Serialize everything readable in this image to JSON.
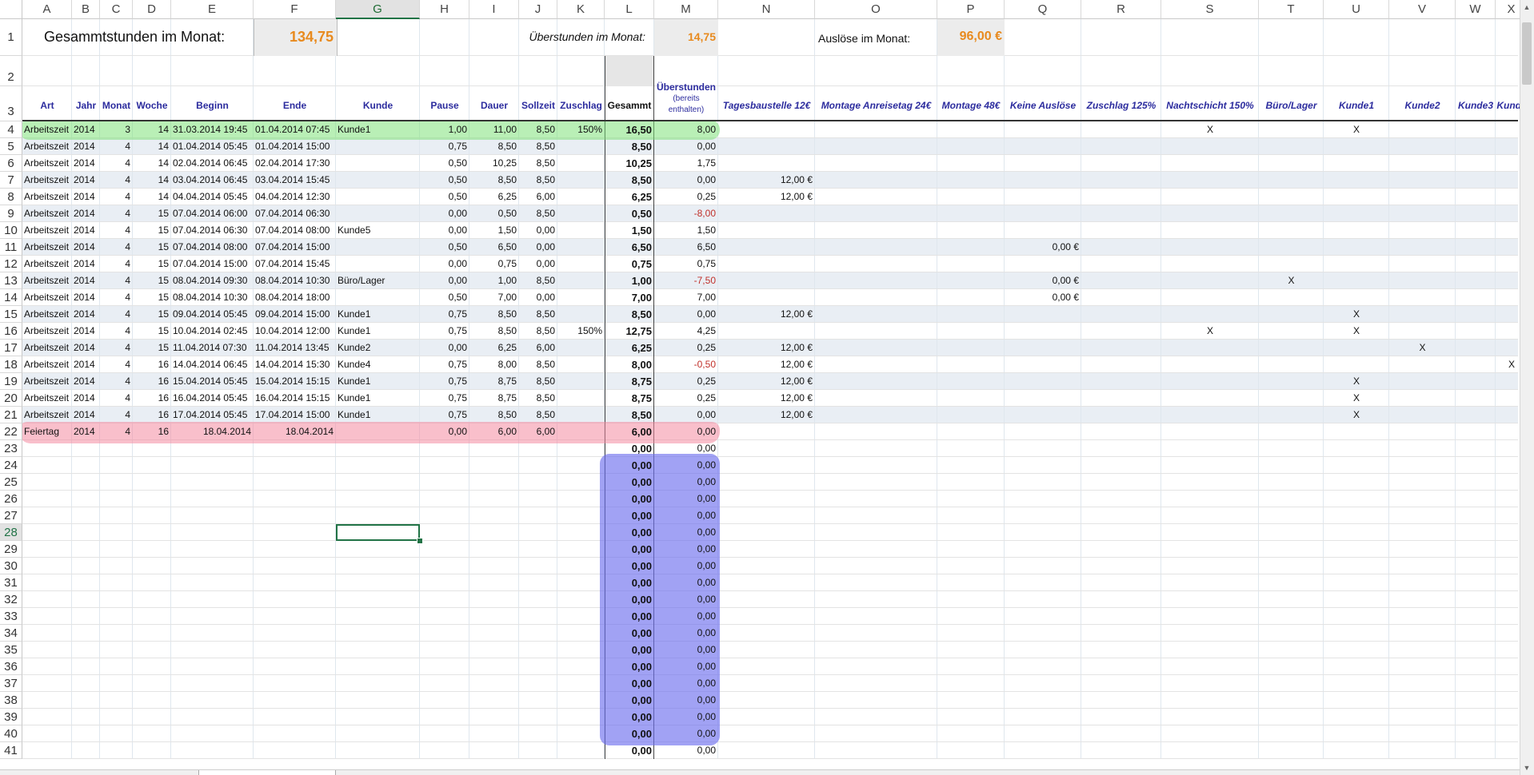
{
  "columns": [
    "A",
    "B",
    "C",
    "D",
    "E",
    "F",
    "G",
    "H",
    "I",
    "J",
    "K",
    "L",
    "M",
    "N",
    "O",
    "P",
    "Q",
    "R",
    "S",
    "T",
    "U",
    "V",
    "W",
    "X"
  ],
  "selected_column": "G",
  "selected_row": 28,
  "row_numbers": [
    1,
    2,
    3,
    4,
    5,
    6,
    7,
    8,
    9,
    10,
    11,
    12,
    13,
    14,
    15,
    16,
    17,
    18,
    19,
    20,
    21,
    22,
    23,
    24,
    25,
    26,
    27,
    28,
    29,
    30,
    31,
    32,
    33,
    34,
    35,
    36,
    37,
    38,
    39,
    40,
    41
  ],
  "summary": {
    "hours_label": "Gesammtstunden im Monat:",
    "hours_value": "134,75",
    "overtime_label": "Überstunden im Monat:",
    "overtime_value": "14,75",
    "allowance_label": "Auslöse im Monat:",
    "allowance_value": "96,00 €"
  },
  "headers": {
    "art": "Art",
    "jahr": "Jahr",
    "monat": "Monat",
    "woche": "Woche",
    "beginn": "Beginn",
    "ende": "Ende",
    "kunde": "Kunde",
    "pause": "Pause",
    "dauer": "Dauer",
    "sollzeit": "Sollzeit",
    "zuschlag": "Zuschlag",
    "gesammt": "Gesammt",
    "ueberstunden": "Überstunden",
    "ueberstunden_sub1": "(bereits",
    "ueberstunden_sub2": "enthalten)",
    "tagesbaustelle": "Tagesbaustelle 12€",
    "montage_anreise": "Montage Anreisetag 24€",
    "montage48": "Montage 48€",
    "keine_ausloese": "Keine Auslöse",
    "zuschlag125": "Zuschlag 125%",
    "nachtschicht": "Nachtschicht 150%",
    "buero": "Büro/Lager",
    "kunde1": "Kunde1",
    "kunde2": "Kunde2",
    "kunde3": "Kunde3",
    "kunde_x": "Kunde"
  },
  "rows": [
    {
      "row": 4,
      "art": "Arbeitszeit",
      "jahr": "2014",
      "monat": "3",
      "woche": "14",
      "beginn": "31.03.2014 19:45",
      "ende": "01.04.2014 07:45",
      "kunde": "Kunde1",
      "pause": "1,00",
      "dauer": "11,00",
      "soll": "8,50",
      "zuschlag": "150%",
      "gesammt": "16,50",
      "ueber": "8,00",
      "tages": "",
      "keine": "",
      "nacht": "X",
      "buero": "",
      "k1": "X",
      "k2": "",
      "kx": ""
    },
    {
      "row": 5,
      "art": "Arbeitszeit",
      "jahr": "2014",
      "monat": "4",
      "woche": "14",
      "beginn": "01.04.2014 05:45",
      "ende": "01.04.2014 15:00",
      "kunde": "",
      "pause": "0,75",
      "dauer": "8,50",
      "soll": "8,50",
      "zuschlag": "",
      "gesammt": "8,50",
      "ueber": "0,00",
      "tages": "",
      "keine": "",
      "nacht": "",
      "buero": "",
      "k1": "",
      "k2": "",
      "kx": ""
    },
    {
      "row": 6,
      "art": "Arbeitszeit",
      "jahr": "2014",
      "monat": "4",
      "woche": "14",
      "beginn": "02.04.2014 06:45",
      "ende": "02.04.2014 17:30",
      "kunde": "",
      "pause": "0,50",
      "dauer": "10,25",
      "soll": "8,50",
      "zuschlag": "",
      "gesammt": "10,25",
      "ueber": "1,75",
      "tages": "",
      "keine": "",
      "nacht": "",
      "buero": "",
      "k1": "",
      "k2": "",
      "kx": ""
    },
    {
      "row": 7,
      "art": "Arbeitszeit",
      "jahr": "2014",
      "monat": "4",
      "woche": "14",
      "beginn": "03.04.2014 06:45",
      "ende": "03.04.2014 15:45",
      "kunde": "",
      "pause": "0,50",
      "dauer": "8,50",
      "soll": "8,50",
      "zuschlag": "",
      "gesammt": "8,50",
      "ueber": "0,00",
      "tages": "12,00 €",
      "keine": "",
      "nacht": "",
      "buero": "",
      "k1": "",
      "k2": "",
      "kx": ""
    },
    {
      "row": 8,
      "art": "Arbeitszeit",
      "jahr": "2014",
      "monat": "4",
      "woche": "14",
      "beginn": "04.04.2014 05:45",
      "ende": "04.04.2014 12:30",
      "kunde": "",
      "pause": "0,50",
      "dauer": "6,25",
      "soll": "6,00",
      "zuschlag": "",
      "gesammt": "6,25",
      "ueber": "0,25",
      "tages": "12,00 €",
      "keine": "",
      "nacht": "",
      "buero": "",
      "k1": "",
      "k2": "",
      "kx": ""
    },
    {
      "row": 9,
      "art": "Arbeitszeit",
      "jahr": "2014",
      "monat": "4",
      "woche": "15",
      "beginn": "07.04.2014 06:00",
      "ende": "07.04.2014 06:30",
      "kunde": "",
      "pause": "0,00",
      "dauer": "0,50",
      "soll": "8,50",
      "zuschlag": "",
      "gesammt": "0,50",
      "ueber": "-8,00",
      "tages": "",
      "keine": "",
      "nacht": "",
      "buero": "",
      "k1": "",
      "k2": "",
      "kx": ""
    },
    {
      "row": 10,
      "art": "Arbeitszeit",
      "jahr": "2014",
      "monat": "4",
      "woche": "15",
      "beginn": "07.04.2014 06:30",
      "ende": "07.04.2014 08:00",
      "kunde": "Kunde5",
      "pause": "0,00",
      "dauer": "1,50",
      "soll": "0,00",
      "zuschlag": "",
      "gesammt": "1,50",
      "ueber": "1,50",
      "tages": "",
      "keine": "",
      "nacht": "",
      "buero": "",
      "k1": "",
      "k2": "",
      "kx": ""
    },
    {
      "row": 11,
      "art": "Arbeitszeit",
      "jahr": "2014",
      "monat": "4",
      "woche": "15",
      "beginn": "07.04.2014 08:00",
      "ende": "07.04.2014 15:00",
      "kunde": "",
      "pause": "0,50",
      "dauer": "6,50",
      "soll": "0,00",
      "zuschlag": "",
      "gesammt": "6,50",
      "ueber": "6,50",
      "tages": "",
      "keine": "0,00 €",
      "nacht": "",
      "buero": "",
      "k1": "",
      "k2": "",
      "kx": ""
    },
    {
      "row": 12,
      "art": "Arbeitszeit",
      "jahr": "2014",
      "monat": "4",
      "woche": "15",
      "beginn": "07.04.2014 15:00",
      "ende": "07.04.2014 15:45",
      "kunde": "",
      "pause": "0,00",
      "dauer": "0,75",
      "soll": "0,00",
      "zuschlag": "",
      "gesammt": "0,75",
      "ueber": "0,75",
      "tages": "",
      "keine": "",
      "nacht": "",
      "buero": "",
      "k1": "",
      "k2": "",
      "kx": ""
    },
    {
      "row": 13,
      "art": "Arbeitszeit",
      "jahr": "2014",
      "monat": "4",
      "woche": "15",
      "beginn": "08.04.2014 09:30",
      "ende": "08.04.2014 10:30",
      "kunde": "Büro/Lager",
      "pause": "0,00",
      "dauer": "1,00",
      "soll": "8,50",
      "zuschlag": "",
      "gesammt": "1,00",
      "ueber": "-7,50",
      "tages": "",
      "keine": "0,00 €",
      "nacht": "",
      "buero": "X",
      "k1": "",
      "k2": "",
      "kx": ""
    },
    {
      "row": 14,
      "art": "Arbeitszeit",
      "jahr": "2014",
      "monat": "4",
      "woche": "15",
      "beginn": "08.04.2014 10:30",
      "ende": "08.04.2014 18:00",
      "kunde": "",
      "pause": "0,50",
      "dauer": "7,00",
      "soll": "0,00",
      "zuschlag": "",
      "gesammt": "7,00",
      "ueber": "7,00",
      "tages": "",
      "keine": "0,00 €",
      "nacht": "",
      "buero": "",
      "k1": "",
      "k2": "",
      "kx": ""
    },
    {
      "row": 15,
      "art": "Arbeitszeit",
      "jahr": "2014",
      "monat": "4",
      "woche": "15",
      "beginn": "09.04.2014 05:45",
      "ende": "09.04.2014 15:00",
      "kunde": "Kunde1",
      "pause": "0,75",
      "dauer": "8,50",
      "soll": "8,50",
      "zuschlag": "",
      "gesammt": "8,50",
      "ueber": "0,00",
      "tages": "12,00 €",
      "keine": "",
      "nacht": "",
      "buero": "",
      "k1": "X",
      "k2": "",
      "kx": ""
    },
    {
      "row": 16,
      "art": "Arbeitszeit",
      "jahr": "2014",
      "monat": "4",
      "woche": "15",
      "beginn": "10.04.2014 02:45",
      "ende": "10.04.2014 12:00",
      "kunde": "Kunde1",
      "pause": "0,75",
      "dauer": "8,50",
      "soll": "8,50",
      "zuschlag": "150%",
      "gesammt": "12,75",
      "ueber": "4,25",
      "tages": "",
      "keine": "",
      "nacht": "X",
      "buero": "",
      "k1": "X",
      "k2": "",
      "kx": ""
    },
    {
      "row": 17,
      "art": "Arbeitszeit",
      "jahr": "2014",
      "monat": "4",
      "woche": "15",
      "beginn": "11.04.2014 07:30",
      "ende": "11.04.2014 13:45",
      "kunde": "Kunde2",
      "pause": "0,00",
      "dauer": "6,25",
      "soll": "6,00",
      "zuschlag": "",
      "gesammt": "6,25",
      "ueber": "0,25",
      "tages": "12,00 €",
      "keine": "",
      "nacht": "",
      "buero": "",
      "k1": "",
      "k2": "X",
      "kx": ""
    },
    {
      "row": 18,
      "art": "Arbeitszeit",
      "jahr": "2014",
      "monat": "4",
      "woche": "16",
      "beginn": "14.04.2014 06:45",
      "ende": "14.04.2014 15:30",
      "kunde": "Kunde4",
      "pause": "0,75",
      "dauer": "8,00",
      "soll": "8,50",
      "zuschlag": "",
      "gesammt": "8,00",
      "ueber": "-0,50",
      "tages": "12,00 €",
      "keine": "",
      "nacht": "",
      "buero": "",
      "k1": "",
      "k2": "",
      "kx": "X"
    },
    {
      "row": 19,
      "art": "Arbeitszeit",
      "jahr": "2014",
      "monat": "4",
      "woche": "16",
      "beginn": "15.04.2014 05:45",
      "ende": "15.04.2014 15:15",
      "kunde": "Kunde1",
      "pause": "0,75",
      "dauer": "8,75",
      "soll": "8,50",
      "zuschlag": "",
      "gesammt": "8,75",
      "ueber": "0,25",
      "tages": "12,00 €",
      "keine": "",
      "nacht": "",
      "buero": "",
      "k1": "X",
      "k2": "",
      "kx": ""
    },
    {
      "row": 20,
      "art": "Arbeitszeit",
      "jahr": "2014",
      "monat": "4",
      "woche": "16",
      "beginn": "16.04.2014 05:45",
      "ende": "16.04.2014 15:15",
      "kunde": "Kunde1",
      "pause": "0,75",
      "dauer": "8,75",
      "soll": "8,50",
      "zuschlag": "",
      "gesammt": "8,75",
      "ueber": "0,25",
      "tages": "12,00 €",
      "keine": "",
      "nacht": "",
      "buero": "",
      "k1": "X",
      "k2": "",
      "kx": ""
    },
    {
      "row": 21,
      "art": "Arbeitszeit",
      "jahr": "2014",
      "monat": "4",
      "woche": "16",
      "beginn": "17.04.2014 05:45",
      "ende": "17.04.2014 15:00",
      "kunde": "Kunde1",
      "pause": "0,75",
      "dauer": "8,50",
      "soll": "8,50",
      "zuschlag": "",
      "gesammt": "8,50",
      "ueber": "0,00",
      "tages": "12,00 €",
      "keine": "",
      "nacht": "",
      "buero": "",
      "k1": "X",
      "k2": "",
      "kx": ""
    },
    {
      "row": 22,
      "art": "Feiertag",
      "jahr": "2014",
      "monat": "4",
      "woche": "16",
      "beginn": "18.04.2014",
      "ende": "18.04.2014",
      "kunde": "",
      "pause": "0,00",
      "dauer": "6,00",
      "soll": "6,00",
      "zuschlag": "",
      "gesammt": "6,00",
      "ueber": "0,00",
      "tages": "",
      "keine": "",
      "nacht": "",
      "buero": "",
      "k1": "",
      "k2": "",
      "kx": ""
    }
  ],
  "empty_rows": {
    "from": 23,
    "to": 41,
    "gesammt": "0,00",
    "ueber": "0,00"
  },
  "highlight_colors": {
    "green": "#7fe27a",
    "red": "#f48aa0",
    "blue": "#6f70ee"
  }
}
